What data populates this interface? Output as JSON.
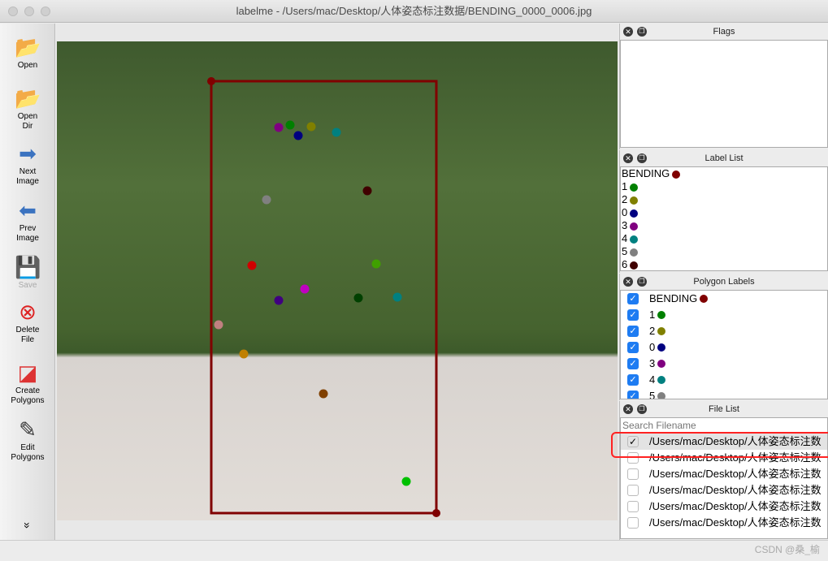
{
  "window": {
    "title": "labelme - /Users/mac/Desktop/人体姿态标注数据/BENDING_0000_0006.jpg"
  },
  "toolbar": [
    {
      "label": "Open",
      "icon": "folder-open-icon"
    },
    {
      "label": "Open\nDir",
      "icon": "folder-open-icon"
    },
    {
      "label": "Next\nImage",
      "icon": "arrow-right-icon"
    },
    {
      "label": "Prev\nImage",
      "icon": "arrow-left-icon"
    },
    {
      "label": "Save",
      "icon": "floppy-icon",
      "disabled": true
    },
    {
      "label": "Delete\nFile",
      "icon": "delete-icon"
    },
    {
      "label": "Create\nPolygons",
      "icon": "create-polygon-icon"
    },
    {
      "label": "Edit\nPolygons",
      "icon": "edit-icon"
    }
  ],
  "flags": {
    "title": "Flags"
  },
  "label_list": {
    "title": "Label List",
    "items": [
      {
        "label": "BENDING",
        "color": "#800000"
      },
      {
        "label": "1",
        "color": "#008000"
      },
      {
        "label": "2",
        "color": "#808000"
      },
      {
        "label": "0",
        "color": "#000080"
      },
      {
        "label": "3",
        "color": "#800080"
      },
      {
        "label": "4",
        "color": "#008080"
      },
      {
        "label": "5",
        "color": "#808080"
      },
      {
        "label": "6",
        "color": "#400000"
      }
    ]
  },
  "polygon_labels": {
    "title": "Polygon Labels",
    "items": [
      {
        "label": "BENDING",
        "color": "#800000",
        "checked": true
      },
      {
        "label": "1",
        "color": "#008000",
        "checked": true
      },
      {
        "label": "2",
        "color": "#808000",
        "checked": true
      },
      {
        "label": "0",
        "color": "#000080",
        "checked": true
      },
      {
        "label": "3",
        "color": "#800080",
        "checked": true
      },
      {
        "label": "4",
        "color": "#008080",
        "checked": true
      },
      {
        "label": "5",
        "color": "#808080",
        "checked": true
      }
    ]
  },
  "file_list": {
    "title": "File List",
    "search_placeholder": "Search Filename",
    "items": [
      {
        "path": "/Users/mac/Desktop/人体姿态标注数",
        "checked": true
      },
      {
        "path": "/Users/mac/Desktop/人体姿态标注数",
        "checked": false
      },
      {
        "path": "/Users/mac/Desktop/人体姿态标注数",
        "checked": false
      },
      {
        "path": "/Users/mac/Desktop/人体姿态标注数",
        "checked": false
      },
      {
        "path": "/Users/mac/Desktop/人体姿态标注数",
        "checked": false
      },
      {
        "path": "/Users/mac/Desktop/人体姿态标注数",
        "checked": false
      }
    ]
  },
  "watermark": "CSDN @桑_榆"
}
